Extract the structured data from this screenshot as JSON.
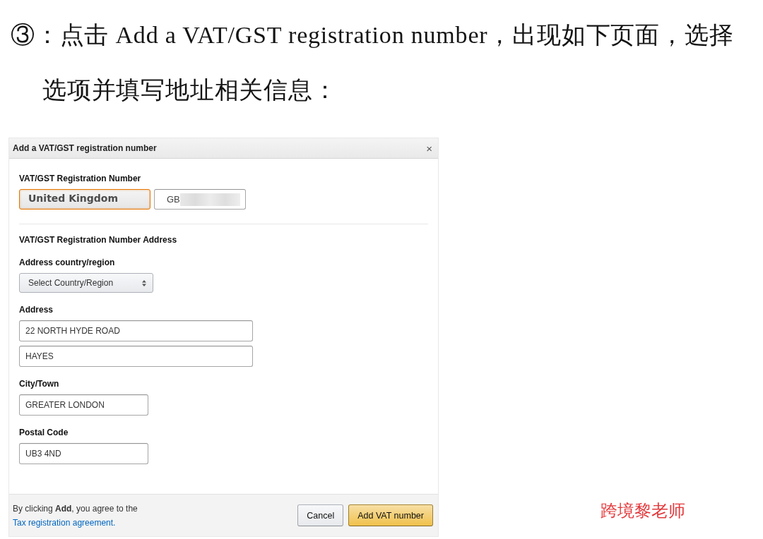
{
  "instruction": {
    "lines": [
      "③：点击 Add a VAT/GST registration number，出现如下页面，选择",
      "选项并填写地址相关信息："
    ]
  },
  "dialog": {
    "title": "Add a VAT/GST registration number",
    "close": "×",
    "registration": {
      "label": "VAT/GST Registration Number",
      "country": "United Kingdom",
      "country_focused": true,
      "number_prefix": "GB",
      "number_redacted": true
    },
    "address_section": {
      "heading": "VAT/GST Registration Number Address",
      "fields": [
        {
          "kind": "select",
          "label": "Address country/region",
          "value": "Select Country/Region"
        },
        {
          "kind": "address",
          "label": "Address",
          "values": [
            "22 NORTH HYDE ROAD",
            "HAYES"
          ]
        },
        {
          "kind": "text",
          "label": "City/Town",
          "values": [
            "GREATER LONDON"
          ]
        },
        {
          "kind": "text",
          "label": "Postal Code",
          "values": [
            "UB3 4ND"
          ]
        }
      ]
    },
    "footer": {
      "notice": "By clicking **Add**, you agree to the",
      "link": "Tax registration agreement.",
      "buttons": [
        {
          "kind": "secondary",
          "label": "Cancel"
        },
        {
          "kind": "primary",
          "label": "Add VAT number"
        }
      ]
    }
  },
  "signature": "跨境黎老师"
}
